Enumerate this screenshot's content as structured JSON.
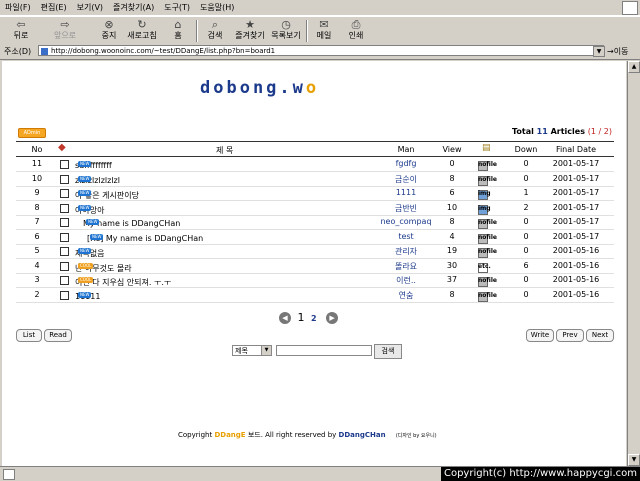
{
  "menu": [
    "파일(F)",
    "편집(E)",
    "보기(V)",
    "즐겨찾기(A)",
    "도구(T)",
    "도움말(H)"
  ],
  "toolbar": {
    "back": "뒤로",
    "forward": "앞으로",
    "stop": "중지",
    "refresh": "새로고침",
    "home": "홈",
    "search": "검색",
    "favorites": "즐겨찾기",
    "history": "목록보기",
    "mail": "메일",
    "print": "인쇄"
  },
  "address": {
    "label": "주소(D)",
    "url": "http://dobong.woonoinc.com/~test/DDangE/list.php?bn=board1",
    "go": "이동"
  },
  "logo": {
    "text": "dobong.w",
    "accent": "o"
  },
  "admin_label": "ADmin",
  "summary": {
    "total_label": "Total",
    "total": "11",
    "articles_label": "Articles",
    "page_open": "(",
    "page_current": "1",
    "page_sep": "/",
    "page_total": "2",
    "page_close": ")"
  },
  "columns": {
    "no": "No",
    "title": "제 목",
    "man": "Man",
    "view": "View",
    "down": "Down",
    "date": "Final Date"
  },
  "rows": [
    {
      "no": "11",
      "title": "sdffffffffff",
      "new": true,
      "cool": false,
      "man": "fgdfg",
      "view": "0",
      "file": "nofile",
      "down": "0",
      "date": "2001-05-17"
    },
    {
      "no": "10",
      "title": "zlzlzlzlzlzlzl",
      "new": true,
      "cool": false,
      "man": "금순이",
      "view": "8",
      "file": "nofile",
      "down": "0",
      "date": "2001-05-17"
    },
    {
      "no": "9",
      "title": "아 좋은 게시판이당",
      "new": true,
      "cool": false,
      "man": "1111",
      "view": "6",
      "file": "img",
      "down": "1",
      "date": "2001-05-17"
    },
    {
      "no": "8",
      "title": "아아앙아",
      "new": true,
      "cool": false,
      "man": "금반빈",
      "view": "10",
      "file": "img",
      "down": "2",
      "date": "2001-05-17"
    },
    {
      "no": "7",
      "title": "My name is DDangCHan",
      "new": true,
      "cool": false,
      "man": "neo_compaq",
      "view": "8",
      "file": "nofile",
      "down": "0",
      "date": "2001-05-17"
    },
    {
      "no": "6",
      "title": "[Re] My name is DDangCHan",
      "new": true,
      "cool": false,
      "man": "test",
      "view": "4",
      "file": "nofile",
      "down": "0",
      "date": "2001-05-17"
    },
    {
      "no": "5",
      "title": "제목없음",
      "new": true,
      "cool": false,
      "man": "관리자",
      "view": "19",
      "file": "nofile",
      "down": "0",
      "date": "2001-05-16"
    },
    {
      "no": "4",
      "title": "난 아무것도 몰라",
      "new": true,
      "cool": true,
      "man": "똘라요",
      "view": "30",
      "file": "etc.",
      "down": "6",
      "date": "2001-05-16"
    },
    {
      "no": "3",
      "title": "이런 다 지우심 안되져. ㅜ.ㅜ",
      "new": true,
      "cool": true,
      "man": "이런..",
      "view": "37",
      "file": "nofile",
      "down": "0",
      "date": "2001-05-16"
    },
    {
      "no": "2",
      "title": "11111",
      "new": true,
      "cool": false,
      "man": "연숨",
      "view": "8",
      "file": "nofile",
      "down": "0",
      "date": "2001-05-16"
    }
  ],
  "badges": {
    "new": "NEW",
    "cool": "COOL"
  },
  "pager": {
    "current": "1",
    "next": "2"
  },
  "buttons": {
    "list": "List",
    "read": "Read",
    "write": "Write",
    "prev": "Prev",
    "next": "Next"
  },
  "search": {
    "field": "제목",
    "button": "검색"
  },
  "footer": {
    "prefix": "Copyright",
    "brand": "DDangE",
    "mid": "보드. All right reserved by",
    "author": "DDangCHan",
    "small": "(디자인 by 요우니)"
  },
  "watermark": "Copyright(c) http://www.happycgi.com"
}
